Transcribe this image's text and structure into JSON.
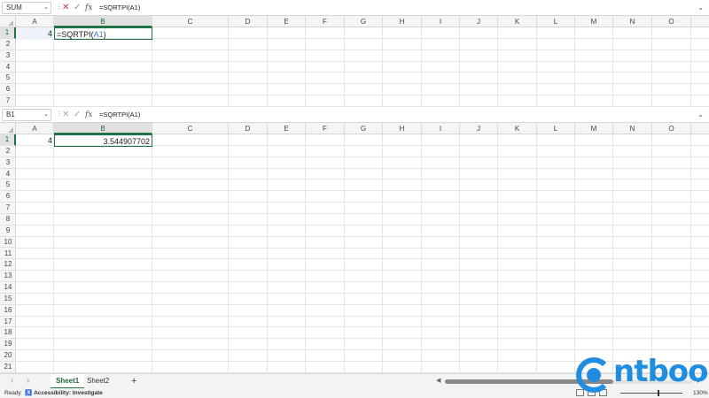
{
  "top_formula_bar": {
    "name_box": "SUM",
    "cancel_icon": "✕",
    "enter_icon": "✓",
    "fx_label": "fx",
    "formula": "=SQRTPI(A1)"
  },
  "bottom_formula_bar": {
    "name_box": "B1",
    "cancel_icon": "✕",
    "enter_icon": "✓",
    "fx_label": "fx",
    "formula": "=SQRTPI(A1)"
  },
  "columns": [
    "A",
    "B",
    "C",
    "D",
    "E",
    "F",
    "G",
    "H",
    "I",
    "J",
    "K",
    "L",
    "M",
    "N",
    "O"
  ],
  "top_rows": [
    "1",
    "2",
    "3",
    "4",
    "5",
    "6",
    "7"
  ],
  "bottom_rows": [
    "1",
    "2",
    "3",
    "4",
    "5",
    "6",
    "7",
    "8",
    "9",
    "10",
    "11",
    "12",
    "13",
    "14",
    "15",
    "16",
    "17",
    "18",
    "19",
    "20",
    "21"
  ],
  "top_sheet": {
    "a1": "4",
    "b1_prefix": "=SQRTPI(",
    "b1_ref": "A1",
    "b1_suffix": ")"
  },
  "bottom_sheet": {
    "a1": "4",
    "b1": "3.544907702"
  },
  "tabs": {
    "prev": "‹",
    "next": "›",
    "sheet1": "Sheet1",
    "sheet2": "Sheet2",
    "add": "+"
  },
  "status": {
    "ready": "Ready",
    "accessibility": "Accessibility: Investigate",
    "zoom": "130%"
  },
  "logo": {
    "text": "ntbook"
  },
  "colors": {
    "accent_green": "#217346",
    "logo_blue": "#1f8ee0",
    "cancel_red": "#c43e3e"
  }
}
